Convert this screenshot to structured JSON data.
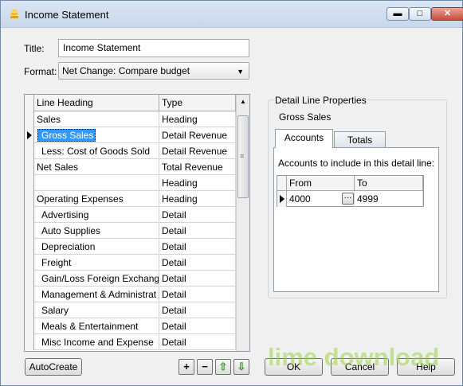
{
  "window": {
    "title": "Income Statement",
    "minimize_glyph": "▬",
    "maximize_glyph": "□",
    "close_glyph": "✕"
  },
  "form": {
    "title_label": "Title:",
    "title_value": "Income Statement",
    "format_label": "Format:",
    "format_value": "Net Change: Compare budget"
  },
  "grid": {
    "headers": [
      "Line Heading",
      "Type"
    ],
    "rows": [
      {
        "heading": "Sales",
        "type": "Heading"
      },
      {
        "heading": "Gross Sales",
        "type": "Detail Revenue"
      },
      {
        "heading": "Less: Cost of Goods Sold",
        "type": "Detail Revenue"
      },
      {
        "heading": "Net Sales",
        "type": "Total Revenue"
      },
      {
        "heading": "",
        "type": "Heading"
      },
      {
        "heading": "Operating Expenses",
        "type": "Heading"
      },
      {
        "heading": "Advertising",
        "type": "Detail"
      },
      {
        "heading": "Auto Supplies",
        "type": "Detail"
      },
      {
        "heading": "Depreciation",
        "type": "Detail"
      },
      {
        "heading": "Freight",
        "type": "Detail"
      },
      {
        "heading": "Gain/Loss Foreign Exchange",
        "type": "Detail"
      },
      {
        "heading": "Management & Administrat",
        "type": "Detail"
      },
      {
        "heading": "Salary",
        "type": "Detail"
      },
      {
        "heading": "Meals & Entertainment",
        "type": "Detail"
      },
      {
        "heading": "Misc Income and Expense",
        "type": "Detail"
      }
    ]
  },
  "detail": {
    "group_title": "Detail Line Properties",
    "line_name": "Gross Sales",
    "tabs": [
      "Accounts",
      "Totals"
    ],
    "accounts_label": "Accounts to include in this detail line:",
    "accounts_headers": [
      "From",
      "To"
    ],
    "accounts_rows": [
      {
        "from": "4000",
        "to": "4999",
        "browse": "···"
      }
    ]
  },
  "buttons": {
    "autocreate": "AutoCreate",
    "add": "+",
    "remove": "−",
    "move_up": "⇧",
    "move_down": "⇩",
    "ok": "OK",
    "cancel": "Cancel",
    "help": "Help"
  },
  "watermark": "lime download"
}
